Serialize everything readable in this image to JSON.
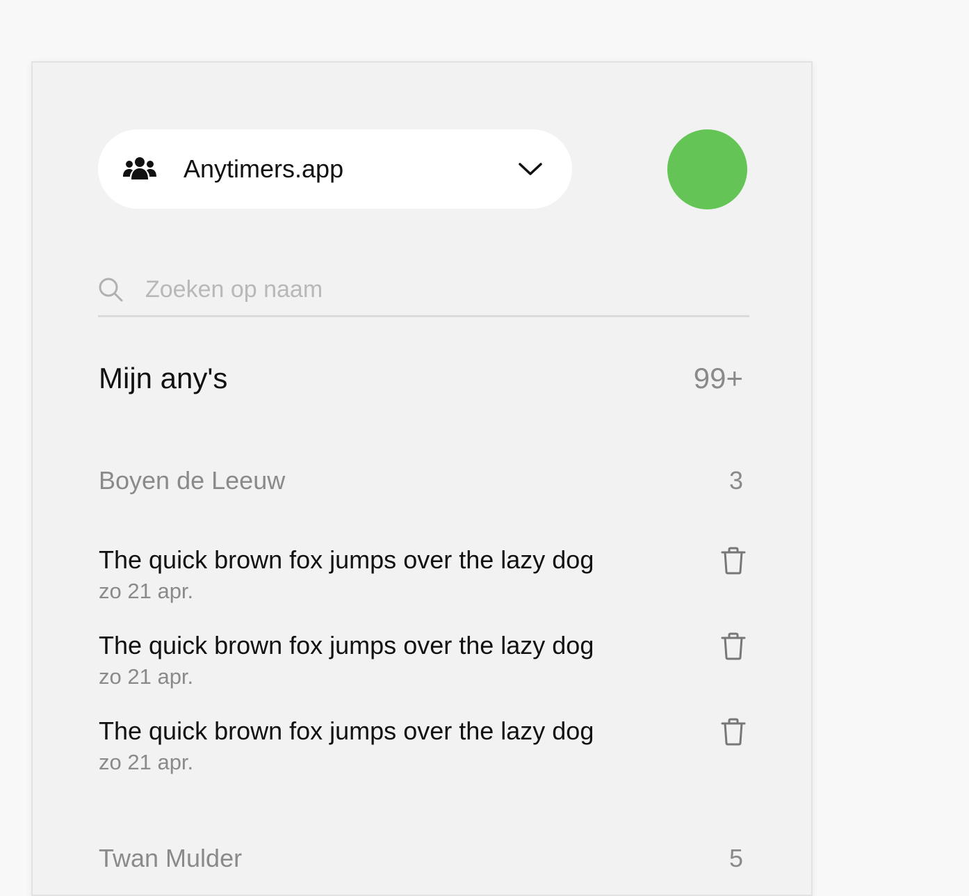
{
  "header": {
    "group_name": "Anytimers.app",
    "group_icon": "users-icon",
    "dropdown_icon": "chevron-down-icon",
    "avatar_color": "#64c556"
  },
  "search": {
    "placeholder": "Zoeken op naam",
    "value": ""
  },
  "section": {
    "title": "Mijn any's",
    "count": "99+"
  },
  "groups": [
    {
      "name": "Boyen de Leeuw",
      "count": "3",
      "items": [
        {
          "text": "The quick brown fox jumps over the lazy dog",
          "date": "zo 21 apr."
        },
        {
          "text": "The quick brown fox jumps over the lazy dog",
          "date": "zo 21 apr."
        },
        {
          "text": "The quick brown fox jumps over the lazy dog",
          "date": "zo 21 apr."
        }
      ]
    },
    {
      "name": "Twan Mulder",
      "count": "5",
      "items": []
    }
  ],
  "colors": {
    "accent": "#64c556",
    "panel_bg": "#f2f2f2",
    "muted_text": "#8a8a8a"
  }
}
